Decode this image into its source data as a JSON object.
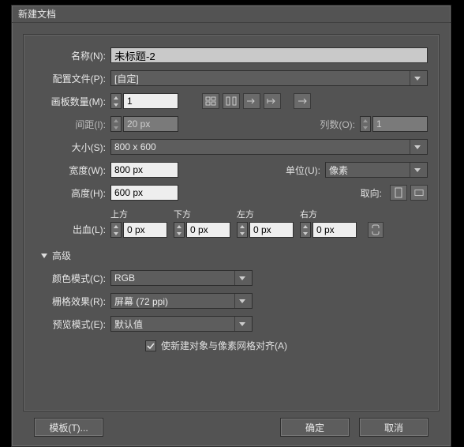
{
  "title": "新建文档",
  "name": {
    "label": "名称(N):",
    "value": "未标题-2"
  },
  "profile": {
    "label": "配置文件(P):",
    "value": "[自定]"
  },
  "artboards": {
    "label": "画板数量(M):",
    "value": "1",
    "spacing": {
      "label": "间距(I):",
      "value": "20 px"
    },
    "columns": {
      "label": "列数(O):",
      "value": "1"
    }
  },
  "size": {
    "label": "大小(S):",
    "value": "800 x 600"
  },
  "width": {
    "label": "宽度(W):",
    "value": "800 px"
  },
  "units": {
    "label": "单位(U):",
    "value": "像素"
  },
  "height": {
    "label": "高度(H):",
    "value": "600 px"
  },
  "orientation": {
    "label": "取向:"
  },
  "bleed": {
    "label": "出血(L):",
    "top": {
      "label": "上方",
      "value": "0 px"
    },
    "bottom": {
      "label": "下方",
      "value": "0 px"
    },
    "left": {
      "label": "左方",
      "value": "0 px"
    },
    "right": {
      "label": "右方",
      "value": "0 px"
    }
  },
  "advanced": {
    "label": "高级",
    "colorMode": {
      "label": "颜色模式(C):",
      "value": "RGB"
    },
    "raster": {
      "label": "栅格效果(R):",
      "value": "屏幕 (72 ppi)"
    },
    "preview": {
      "label": "预览模式(E):",
      "value": "默认值"
    },
    "alignPixel": "使新建对象与像素网格对齐(A)"
  },
  "buttons": {
    "templates": "模板(T)...",
    "ok": "确定",
    "cancel": "取消"
  }
}
